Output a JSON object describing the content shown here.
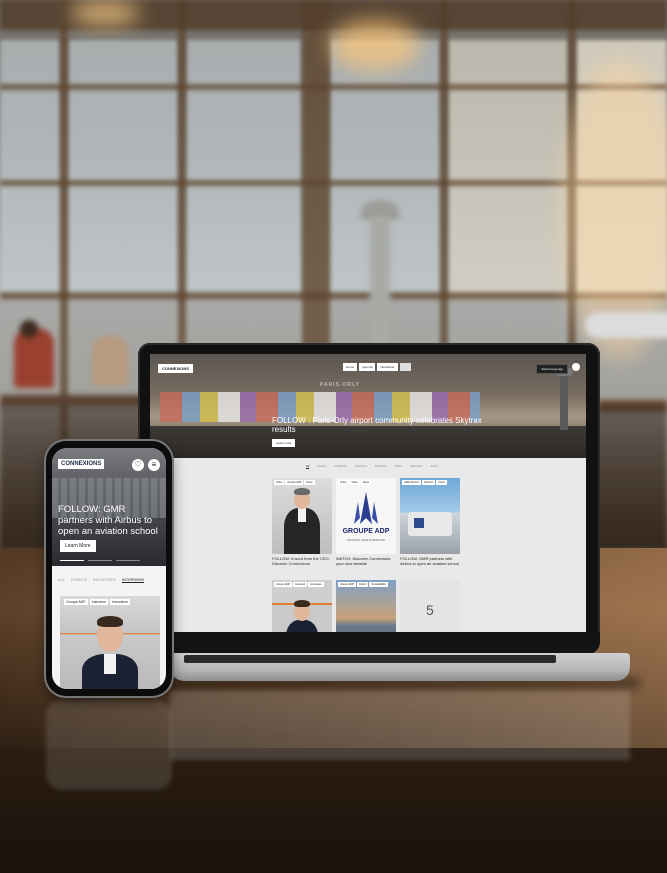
{
  "laptop": {
    "logo": "CONNEXIONS",
    "nav": [
      "Home",
      "Agenda",
      "Newsletter"
    ],
    "language": "Select language",
    "hero_place": "PARIS-ORLY",
    "hero_headline": "FOLLOW : Paris-Orly airport community celebrates Skytrax results",
    "hero_button": "Learn more",
    "tabs": [
      "All",
      "Events",
      "Initiatives",
      "Interview",
      "Partners",
      "Video",
      "Webinars",
      "Zoom"
    ],
    "cards": [
      {
        "caption": "FOLLOW: A word from the CEO, Discover Connexions"
      },
      {
        "caption": "WATCH: Discover Connexions, your new website",
        "brand": "GROUPE ADP",
        "tagline": "SHAPING NEW HORIZONS"
      },
      {
        "caption": "FOLLOW: GMR partners with Airbus to open an aviation school"
      },
      {
        "caption": ""
      },
      {
        "caption": ""
      },
      {
        "caption": "",
        "stat": "5"
      }
    ]
  },
  "phone": {
    "logo": "CONNEXIONS",
    "hero_headline": "FOLLOW: GMR partners with Airbus to open an aviation school",
    "hero_button": "Learn More",
    "tabs": [
      "ALL",
      "EVENTS",
      "INITIATIVES",
      "INTERVIEW"
    ],
    "active_tab": "INTERVIEW",
    "card_tags": [
      "Groupe ADP",
      "Interview",
      "Innovation"
    ]
  }
}
